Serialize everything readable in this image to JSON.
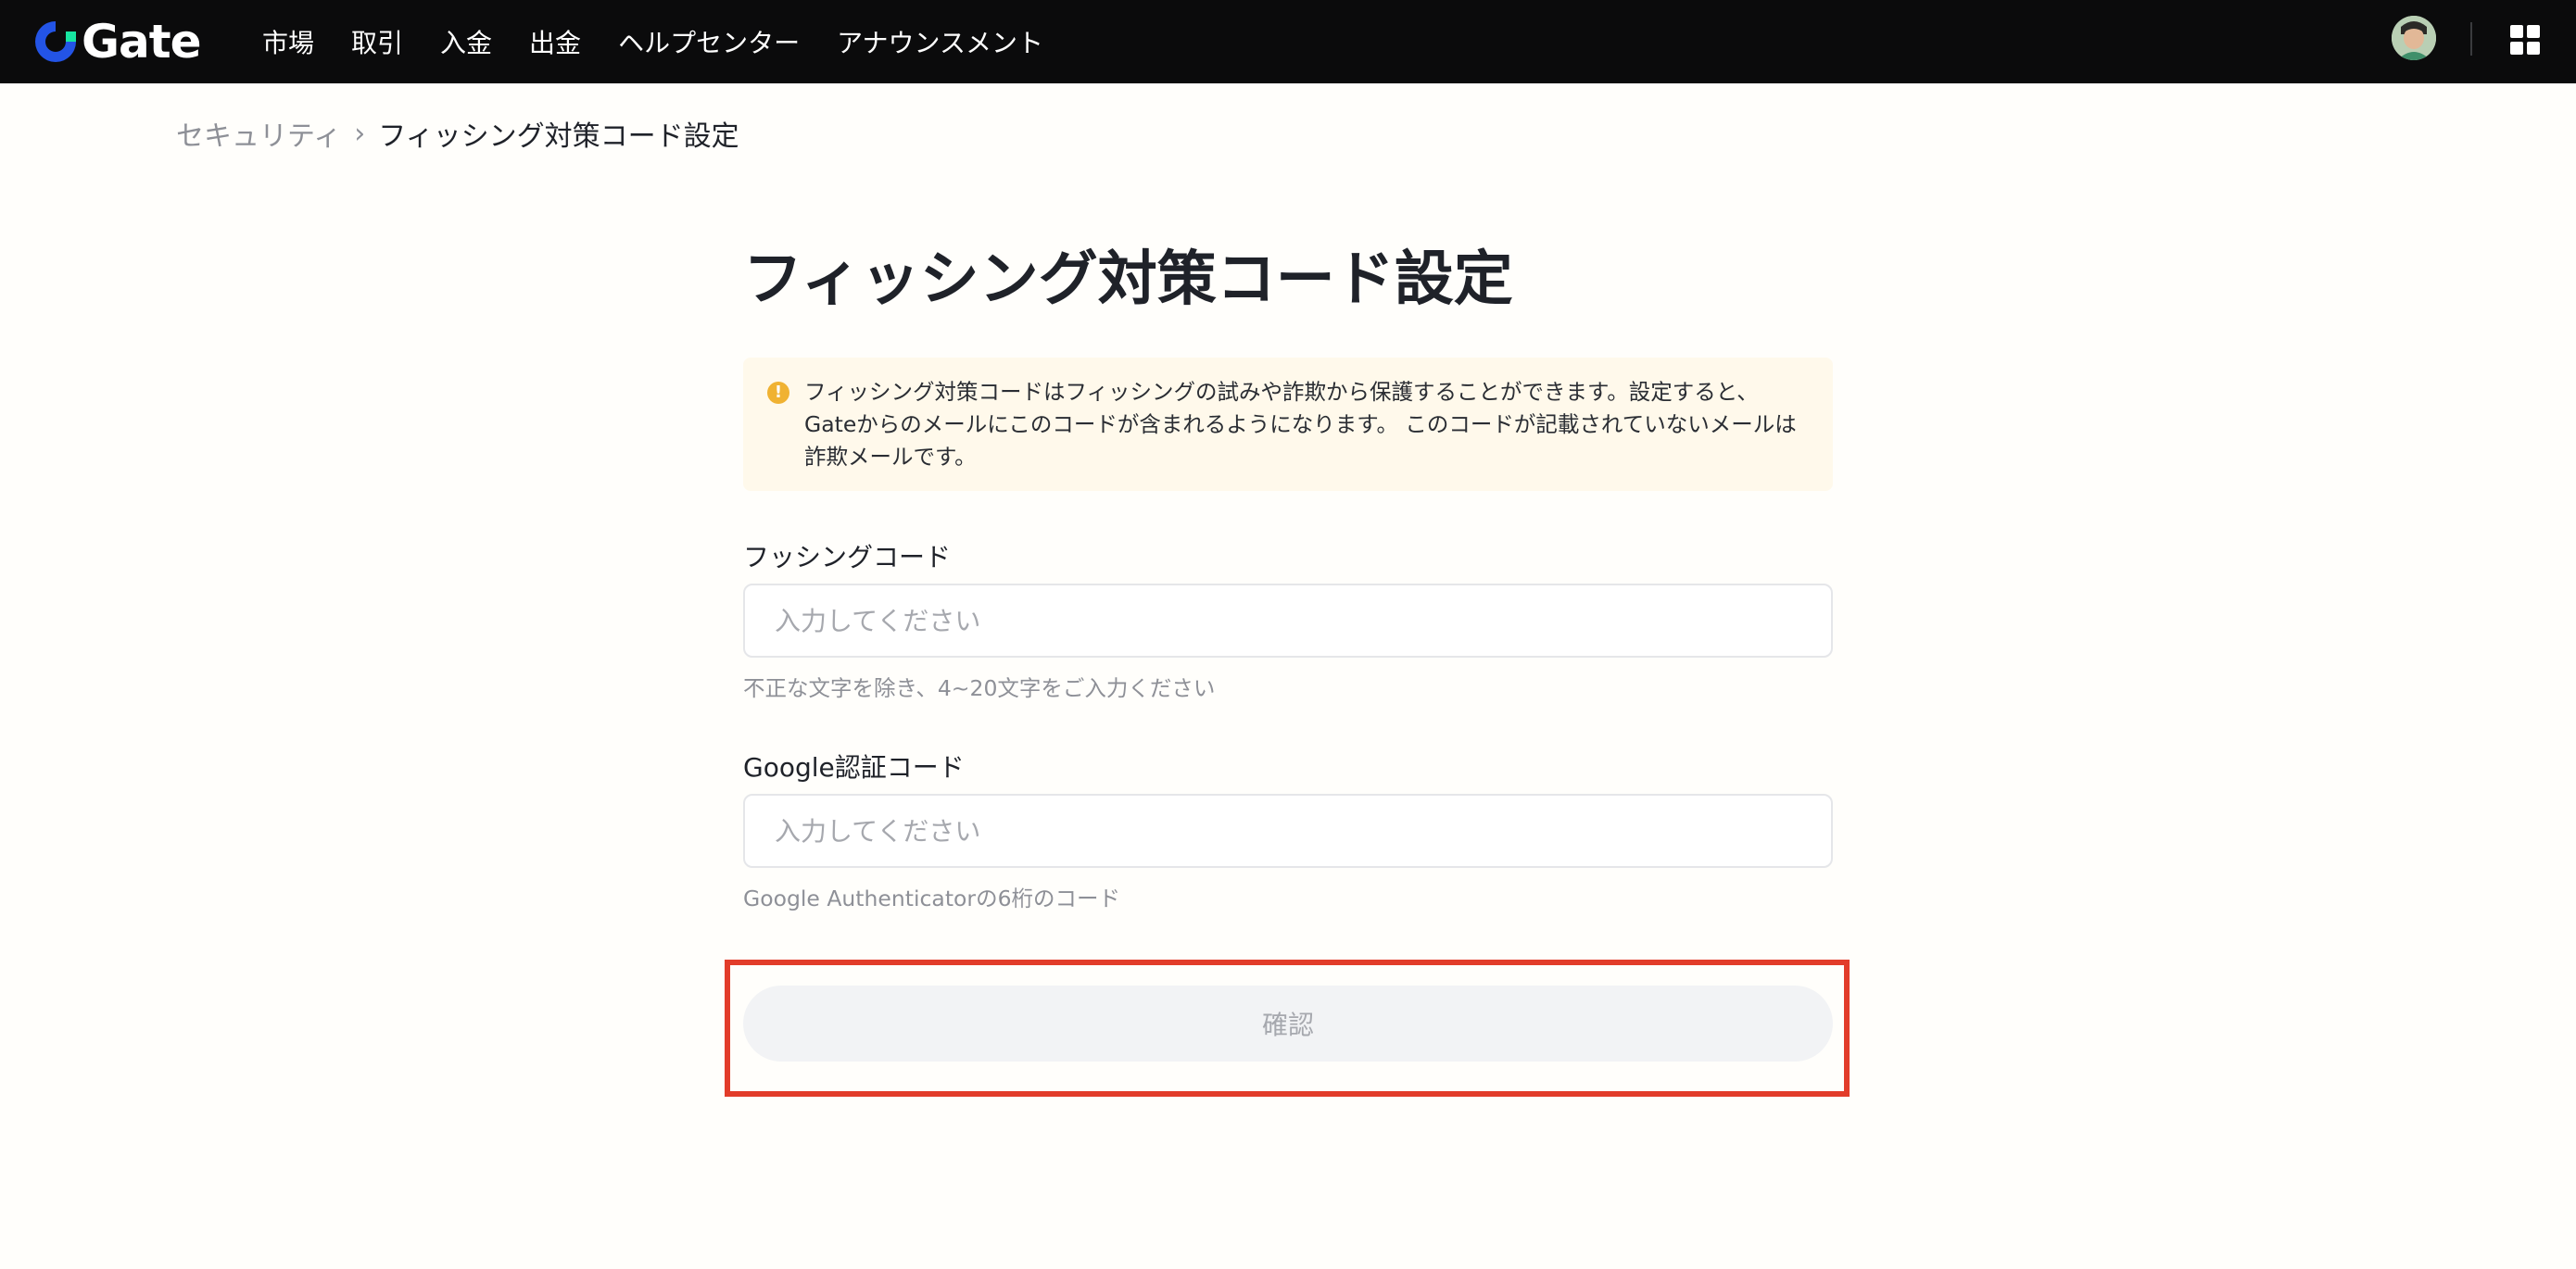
{
  "header": {
    "logo_text": "Gate",
    "nav": [
      {
        "label": "市場"
      },
      {
        "label": "取引"
      },
      {
        "label": "入金"
      },
      {
        "label": "出金"
      },
      {
        "label": "ヘルプセンター"
      },
      {
        "label": "アナウンスメント"
      }
    ],
    "icons": {
      "logo": "gate-logo-icon",
      "avatar": "user-avatar",
      "apps": "grid-apps-icon"
    }
  },
  "breadcrumb": {
    "parent": "セキュリティ",
    "separator": "›",
    "current": "フィッシング対策コード設定"
  },
  "page": {
    "title": "フィッシング対策コード設定",
    "notice": {
      "icon": "warning-icon",
      "text": "フィッシング対策コードはフィッシングの試みや詐欺から保護することができます。設定すると、Gateからのメールにこのコードが含まれるようになります。 このコードが記載されていないメールは詐欺メールです。"
    },
    "phishing_code": {
      "label": "フッシングコード",
      "placeholder": "入力してください",
      "value": "",
      "hint": "不正な文字を除き、4~20文字をご入力ください"
    },
    "google_code": {
      "label": "Google認証コード",
      "placeholder": "入力してください",
      "value": "",
      "hint": "Google Authenticatorの6桁のコード"
    },
    "confirm_label": "確認"
  },
  "colors": {
    "topbar": "#0b0b0c",
    "logo_blue": "#2354e6",
    "logo_green": "#17e5a1",
    "notice_bg": "#fff9eb",
    "warning": "#f0b232",
    "button_bg": "#f2f3f5",
    "highlight": "#e23c2a"
  }
}
